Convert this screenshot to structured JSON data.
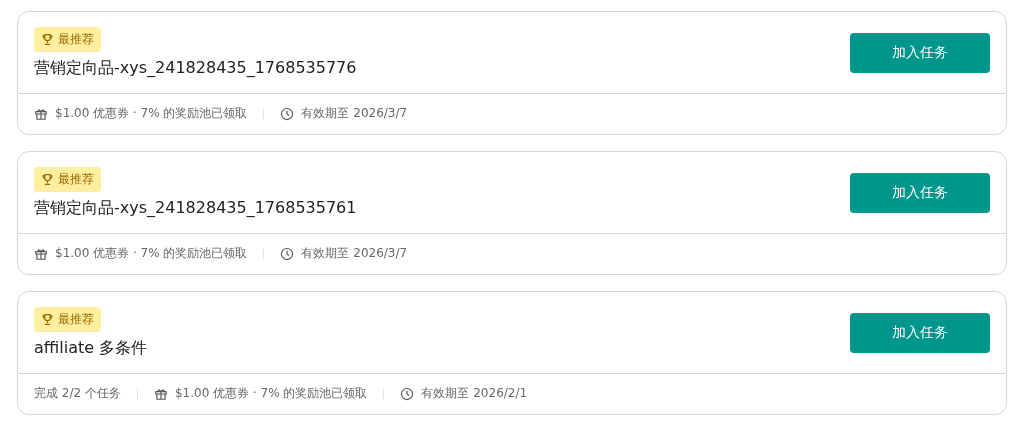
{
  "tasks": [
    {
      "badge": "最推荐",
      "title": "营销定向品-xys_241828435_1768535776",
      "button": "加入任务",
      "meta": [
        {
          "kind": "reward",
          "text": "$1.00 优惠券 · 7% 的奖励池已领取"
        },
        {
          "kind": "expiry",
          "text": "有效期至 2026/3/7"
        }
      ]
    },
    {
      "badge": "最推荐",
      "title": "营销定向品-xys_241828435_1768535761",
      "button": "加入任务",
      "meta": [
        {
          "kind": "reward",
          "text": "$1.00 优惠券 · 7% 的奖励池已领取"
        },
        {
          "kind": "expiry",
          "text": "有效期至 2026/3/7"
        }
      ]
    },
    {
      "badge": "最推荐",
      "title": "affiliate 多条件",
      "button": "加入任务",
      "meta": [
        {
          "kind": "progress",
          "text": "完成 2/2 个任务"
        },
        {
          "kind": "reward",
          "text": "$1.00 优惠券 · 7% 的奖励池已领取"
        },
        {
          "kind": "expiry",
          "text": "有效期至 2026/2/1"
        }
      ]
    }
  ]
}
